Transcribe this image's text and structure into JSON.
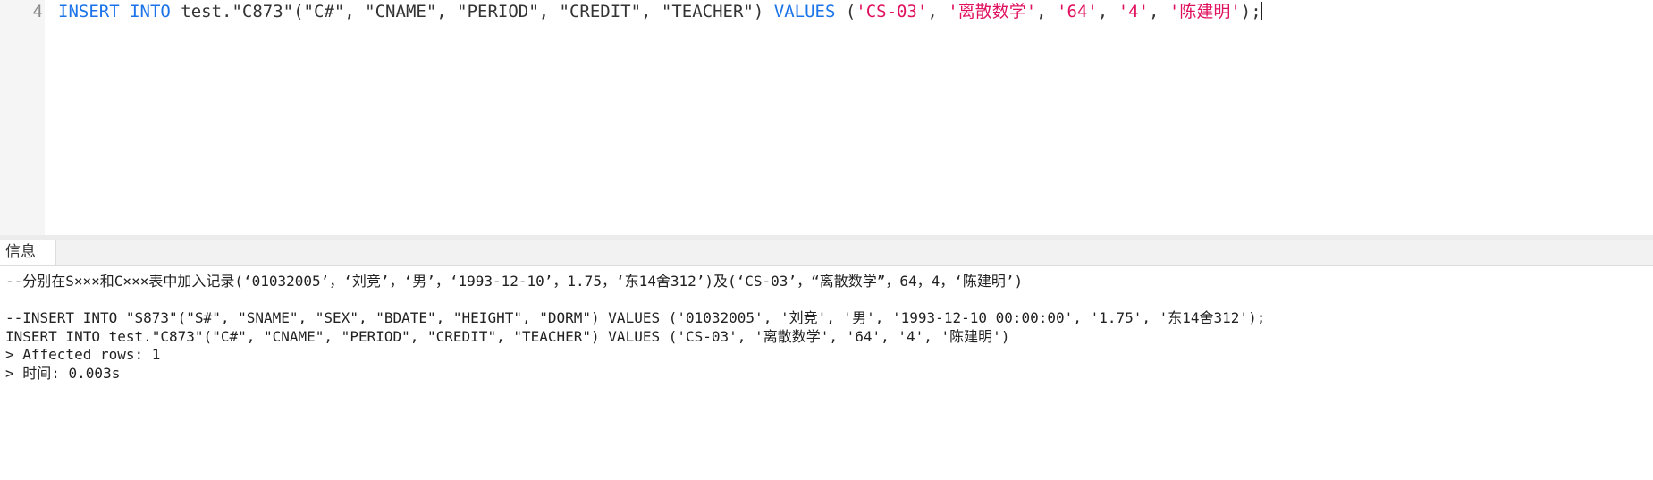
{
  "editor": {
    "line_number": "4",
    "tokens": [
      {
        "t": "INSERT INTO",
        "c": "kw"
      },
      {
        "t": " test.\"C873\"(\"C#\", \"CNAME\", \"PERIOD\", \"CREDIT\", \"TEACHER\") ",
        "c": "plain"
      },
      {
        "t": "VALUES",
        "c": "kw"
      },
      {
        "t": " (",
        "c": "plain"
      },
      {
        "t": "'CS-03'",
        "c": "str"
      },
      {
        "t": ", ",
        "c": "plain"
      },
      {
        "t": "'离散数学'",
        "c": "str"
      },
      {
        "t": ", ",
        "c": "plain"
      },
      {
        "t": "'64'",
        "c": "str"
      },
      {
        "t": ", ",
        "c": "plain"
      },
      {
        "t": "'4'",
        "c": "str"
      },
      {
        "t": ", ",
        "c": "plain"
      },
      {
        "t": "'陈建明'",
        "c": "str"
      },
      {
        "t": ");",
        "c": "plain"
      }
    ]
  },
  "results_panel": {
    "tab_label": "信息",
    "lines": [
      "--分别在S×××和C×××表中加入记录(‘01032005’，‘刘竞’，‘男’，‘1993-12-10’，1.75，‘东14舍312’)及(‘CS-03’，“离散数学”，64，4，‘陈建明’)",
      "",
      "--INSERT INTO \"S873\"(\"S#\", \"SNAME\", \"SEX\", \"BDATE\", \"HEIGHT\", \"DORM\") VALUES ('01032005', '刘竞', '男', '1993-12-10 00:00:00', '1.75', '东14舍312');",
      "INSERT INTO test.\"C873\"(\"C#\", \"CNAME\", \"PERIOD\", \"CREDIT\", \"TEACHER\") VALUES ('CS-03', '离散数学', '64', '4', '陈建明')",
      "> Affected rows: 1",
      "> 时间: 0.003s"
    ]
  }
}
